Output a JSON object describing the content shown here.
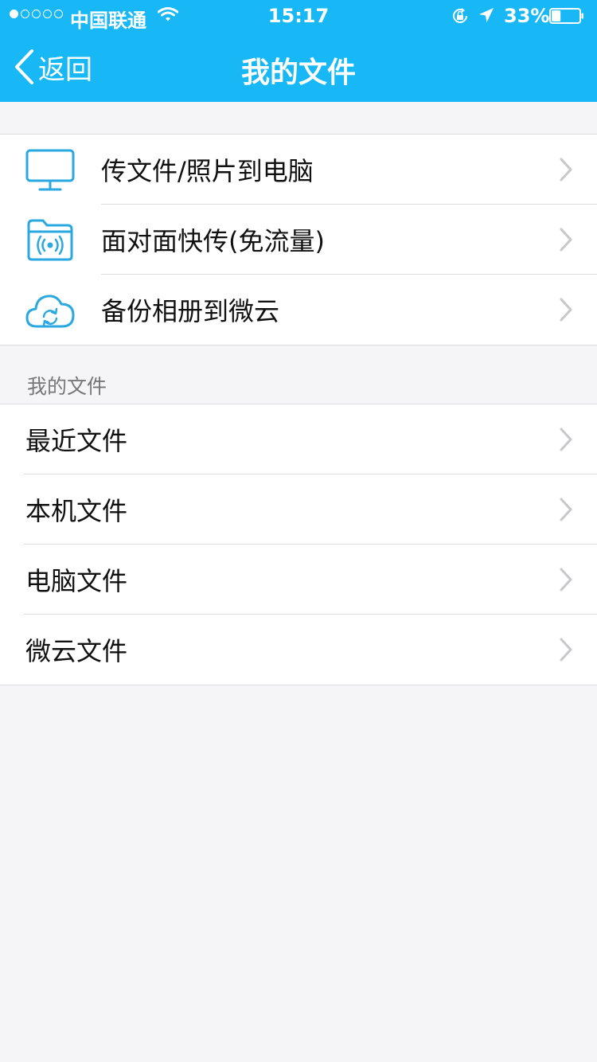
{
  "status_bar": {
    "carrier": "中国联通",
    "time": "15:17",
    "battery_percent": "33%",
    "battery_level": 0.33,
    "signal_bars_filled": 1,
    "signal_bars_total": 5
  },
  "navbar": {
    "back_label": "返回",
    "title": "我的文件",
    "background_color": "#17b8f5"
  },
  "quick_actions": [
    {
      "label": "传文件/照片到电脑",
      "icon": "monitor-icon"
    },
    {
      "label": "面对面快传(免流量)",
      "icon": "folder-wireless-icon"
    },
    {
      "label": "备份相册到微云",
      "icon": "cloud-sync-icon"
    }
  ],
  "files_section": {
    "header": "我的文件",
    "items": [
      {
        "label": "最近文件"
      },
      {
        "label": "本机文件"
      },
      {
        "label": "电脑文件"
      },
      {
        "label": "微云文件"
      }
    ]
  },
  "colors": {
    "accent": "#17b8f5",
    "icon_blue": "#2aa8e0",
    "chevron": "#c7c7cc"
  }
}
